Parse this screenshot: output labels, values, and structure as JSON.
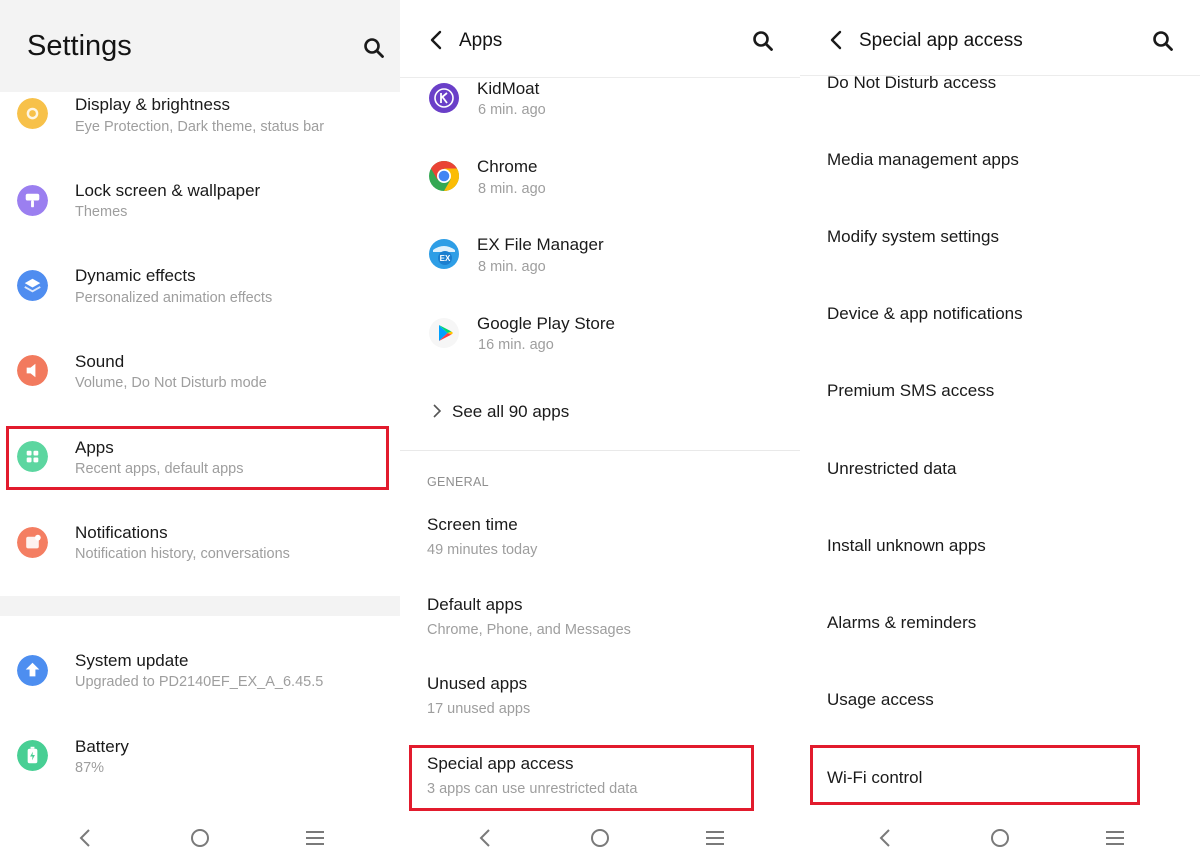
{
  "settings": {
    "title": "Settings",
    "items": [
      {
        "title": "Display & brightness",
        "subtitle": "Eye Protection, Dark theme, status bar",
        "icon": "display-brightness-icon",
        "color": "#f7c14a"
      },
      {
        "title": "Lock screen & wallpaper",
        "subtitle": "Themes",
        "icon": "lock-screen-wallpaper-icon",
        "color": "#9b7ff0"
      },
      {
        "title": "Dynamic effects",
        "subtitle": "Personalized animation effects",
        "icon": "dynamic-effects-icon",
        "color": "#4f8df0"
      },
      {
        "title": "Sound",
        "subtitle": "Volume, Do Not Disturb mode",
        "icon": "sound-icon",
        "color": "#f27a5e"
      },
      {
        "title": "Apps",
        "subtitle": "Recent apps, default apps",
        "icon": "apps-icon",
        "color": "#5cd6a0"
      },
      {
        "title": "Notifications",
        "subtitle": "Notification history, conversations",
        "icon": "notifications-icon",
        "color": "#f47e62"
      },
      {
        "title": "System update",
        "subtitle": "Upgraded to PD2140EF_EX_A_6.45.5",
        "icon": "system-update-icon",
        "color": "#4d8ef0"
      },
      {
        "title": "Battery",
        "subtitle": "87%",
        "icon": "battery-icon",
        "color": "#48cf94"
      }
    ]
  },
  "apps": {
    "title": "Apps",
    "recent": [
      {
        "name": "KidMoat",
        "time": "6 min. ago",
        "icon": "kidmoat-icon"
      },
      {
        "name": "Chrome",
        "time": "8 min. ago",
        "icon": "chrome-icon"
      },
      {
        "name": "EX File Manager",
        "time": "8 min. ago",
        "icon": "ex-file-manager-icon"
      },
      {
        "name": "Google Play Store",
        "time": "16 min. ago",
        "icon": "google-play-store-icon"
      }
    ],
    "see_all": "See all 90 apps",
    "section_label": "GENERAL",
    "general": [
      {
        "title": "Screen time",
        "subtitle": "49 minutes today"
      },
      {
        "title": "Default apps",
        "subtitle": "Chrome, Phone, and Messages"
      },
      {
        "title": "Unused apps",
        "subtitle": "17 unused apps"
      },
      {
        "title": "Special app access",
        "subtitle": "3 apps can use unrestricted data"
      }
    ]
  },
  "special": {
    "title": "Special app access",
    "items": [
      "Do Not Disturb access",
      "Media management apps",
      "Modify system settings",
      "Device & app notifications",
      "Premium SMS access",
      "Unrestricted data",
      "Install unknown apps",
      "Alarms & reminders",
      "Usage access",
      "Wi-Fi control"
    ]
  },
  "colors": {
    "highlight": "#e21b2d",
    "secondary_text": "#9e9e9e",
    "header_bg": "#f3f3f3"
  }
}
